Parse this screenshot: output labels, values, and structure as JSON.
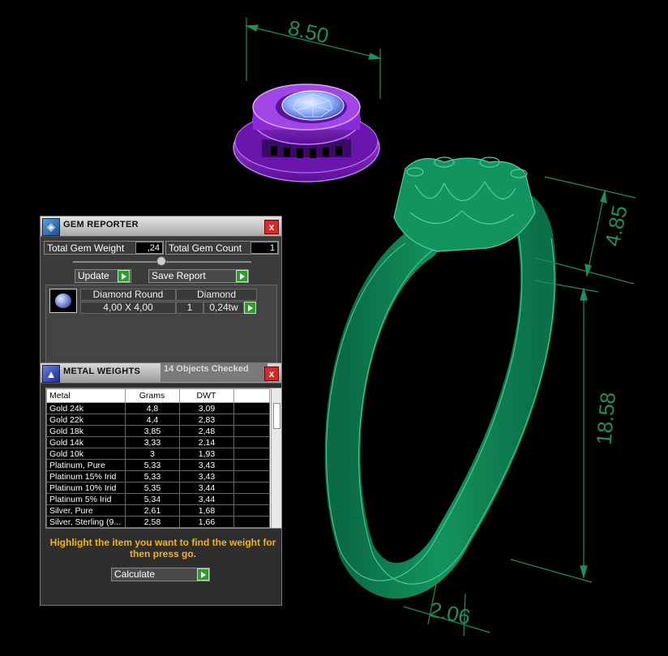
{
  "model": {
    "dimensions": {
      "top_width": "8.50",
      "head_height": "4.85",
      "shank_height": "18.58",
      "band_width": "2.06"
    },
    "colors": {
      "setting": "#7a1fc4",
      "gem": "#8fb0ff",
      "ring": "#0f7a4f",
      "dimension_line": "#1e8f5c"
    }
  },
  "gem_reporter": {
    "title": "GEM REPORTER",
    "icon": "gem-reporter-icon",
    "close": "x",
    "total_gem_weight_label": "Total Gem Weight",
    "total_gem_weight": ",24",
    "total_gem_count_label": "Total Gem Count",
    "total_gem_count": "1",
    "update_label": "Update",
    "save_report_label": "Save Report",
    "gem": {
      "cut": "Diamond Round",
      "size": "4,00 X 4,00",
      "material": "Diamond",
      "count": "1",
      "weight": "0,24tw"
    }
  },
  "metal_weights": {
    "title": "METAL WEIGHTS",
    "status": "14 Objects Checked",
    "close": "x",
    "columns": [
      "Metal",
      "Grams",
      "DWT"
    ],
    "rows": [
      [
        "Gold 24k",
        "4,8",
        "3,09"
      ],
      [
        "Gold 22k",
        "4,4",
        "2,83"
      ],
      [
        "Gold 18k",
        "3,85",
        "2,48"
      ],
      [
        "Gold 14k",
        "3,33",
        "2,14"
      ],
      [
        "Gold 10k",
        "3",
        "1,93"
      ],
      [
        "Platinum, Pure",
        "5,33",
        "3,43"
      ],
      [
        "Platinum 15% Irid",
        "5,33",
        "3,43"
      ],
      [
        "Platinum 10% Irid",
        "5,35",
        "3,44"
      ],
      [
        "Platinum 5% Irid",
        "5,34",
        "3,44"
      ],
      [
        "Silver, Pure",
        "2,61",
        "1,68"
      ],
      [
        "Silver, Sterling (9...",
        "2,58",
        "1,66"
      ]
    ],
    "hint": "Highlight the item you want to find the weight for then press go.",
    "calculate_label": "Calculate"
  }
}
